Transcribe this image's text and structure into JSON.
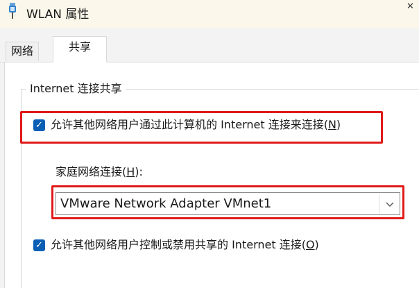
{
  "window": {
    "title": "WLAN 属性",
    "close_glyph": "✕"
  },
  "tabs": [
    {
      "label": "网络",
      "selected": false
    },
    {
      "label": "共享",
      "selected": true
    }
  ],
  "groupbox": {
    "legend": "Internet 连接共享"
  },
  "allow_sharing": {
    "checked": true,
    "label_prefix": "允许其他网络用户通过此计算机的 Internet 连接来连接(",
    "mnemonic": "N",
    "label_suffix": ")"
  },
  "home_network": {
    "label_prefix": "家庭网络连接(",
    "mnemonic": "H",
    "label_suffix": "):",
    "selected_value": "VMware Network Adapter VMnet1"
  },
  "allow_control": {
    "checked": true,
    "label_prefix": "允许其他网络用户控制或禁用共享的 Internet 连接(",
    "mnemonic": "O",
    "label_suffix": ")"
  },
  "icons": {
    "title_icon": "network-adapter-icon",
    "checkmark": "checkmark-icon",
    "dropdown": "chevron-down-icon"
  },
  "colors": {
    "accent": "#0a5fb4",
    "highlight": "#e01a1a",
    "titlebar": "#fbf7ea"
  }
}
